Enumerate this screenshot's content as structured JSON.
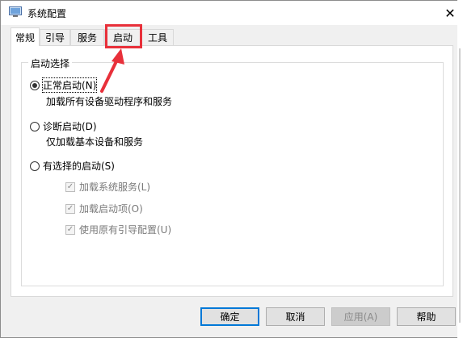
{
  "window": {
    "title": "系统配置",
    "close_label": "✕"
  },
  "tabs": [
    {
      "label": "常规",
      "active": true
    },
    {
      "label": "引导",
      "active": false
    },
    {
      "label": "服务",
      "active": false
    },
    {
      "label": "启动",
      "active": false
    },
    {
      "label": "工具",
      "active": false
    }
  ],
  "startup_selection": {
    "group_label": "启动选择",
    "normal": {
      "label": "正常启动(N)",
      "desc": "加载所有设备驱动程序和服务",
      "checked": true
    },
    "diagnostic": {
      "label": "诊断启动(D)",
      "desc": "仅加载基本设备和服务",
      "checked": false
    },
    "selective": {
      "label": "有选择的启动(S)",
      "checked": false
    },
    "options": [
      {
        "label": "加载系统服务(L)",
        "checked": true
      },
      {
        "label": "加载启动项(O)",
        "checked": true
      },
      {
        "label": "使用原有引导配置(U)",
        "checked": true
      }
    ]
  },
  "buttons": {
    "ok": "确定",
    "cancel": "取消",
    "apply": "应用(A)",
    "help": "帮助"
  },
  "colors": {
    "accent": "#0078d7",
    "annotation": "#e8303a"
  }
}
